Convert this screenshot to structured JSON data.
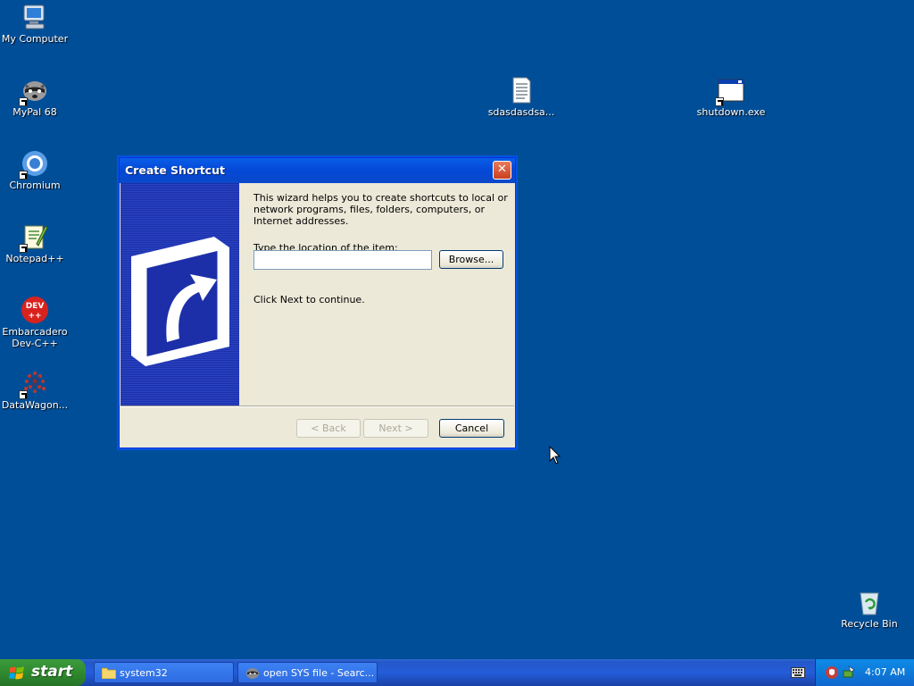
{
  "desktop": {
    "icons": [
      {
        "label": "My Computer"
      },
      {
        "label": "MyPal 68"
      },
      {
        "label": "Chromium"
      },
      {
        "label": "Notepad++"
      },
      {
        "label": "Embarcadero Dev-C++"
      },
      {
        "label": "DataWagon..."
      },
      {
        "label": "sdasdasdsa..."
      },
      {
        "label": "shutdown.exe"
      },
      {
        "label": "Recycle Bin"
      }
    ],
    "background_color": "#004e98"
  },
  "dialog": {
    "title": "Create Shortcut",
    "intro": "This wizard helps you to create shortcuts to local or network programs, files, folders, computers, or Internet addresses.",
    "location_label": "Type the location of the item:",
    "location_value": "",
    "browse_label": "Browse...",
    "continue_text": "Click Next to continue.",
    "back_label": "< Back",
    "next_label": "Next >",
    "cancel_label": "Cancel"
  },
  "taskbar": {
    "start_label": "start",
    "tasks": [
      {
        "label": "system32",
        "icon": "folder-icon"
      },
      {
        "label": "open SYS file - Searc...",
        "icon": "browser-icon"
      }
    ],
    "clock": "4:07 AM"
  }
}
